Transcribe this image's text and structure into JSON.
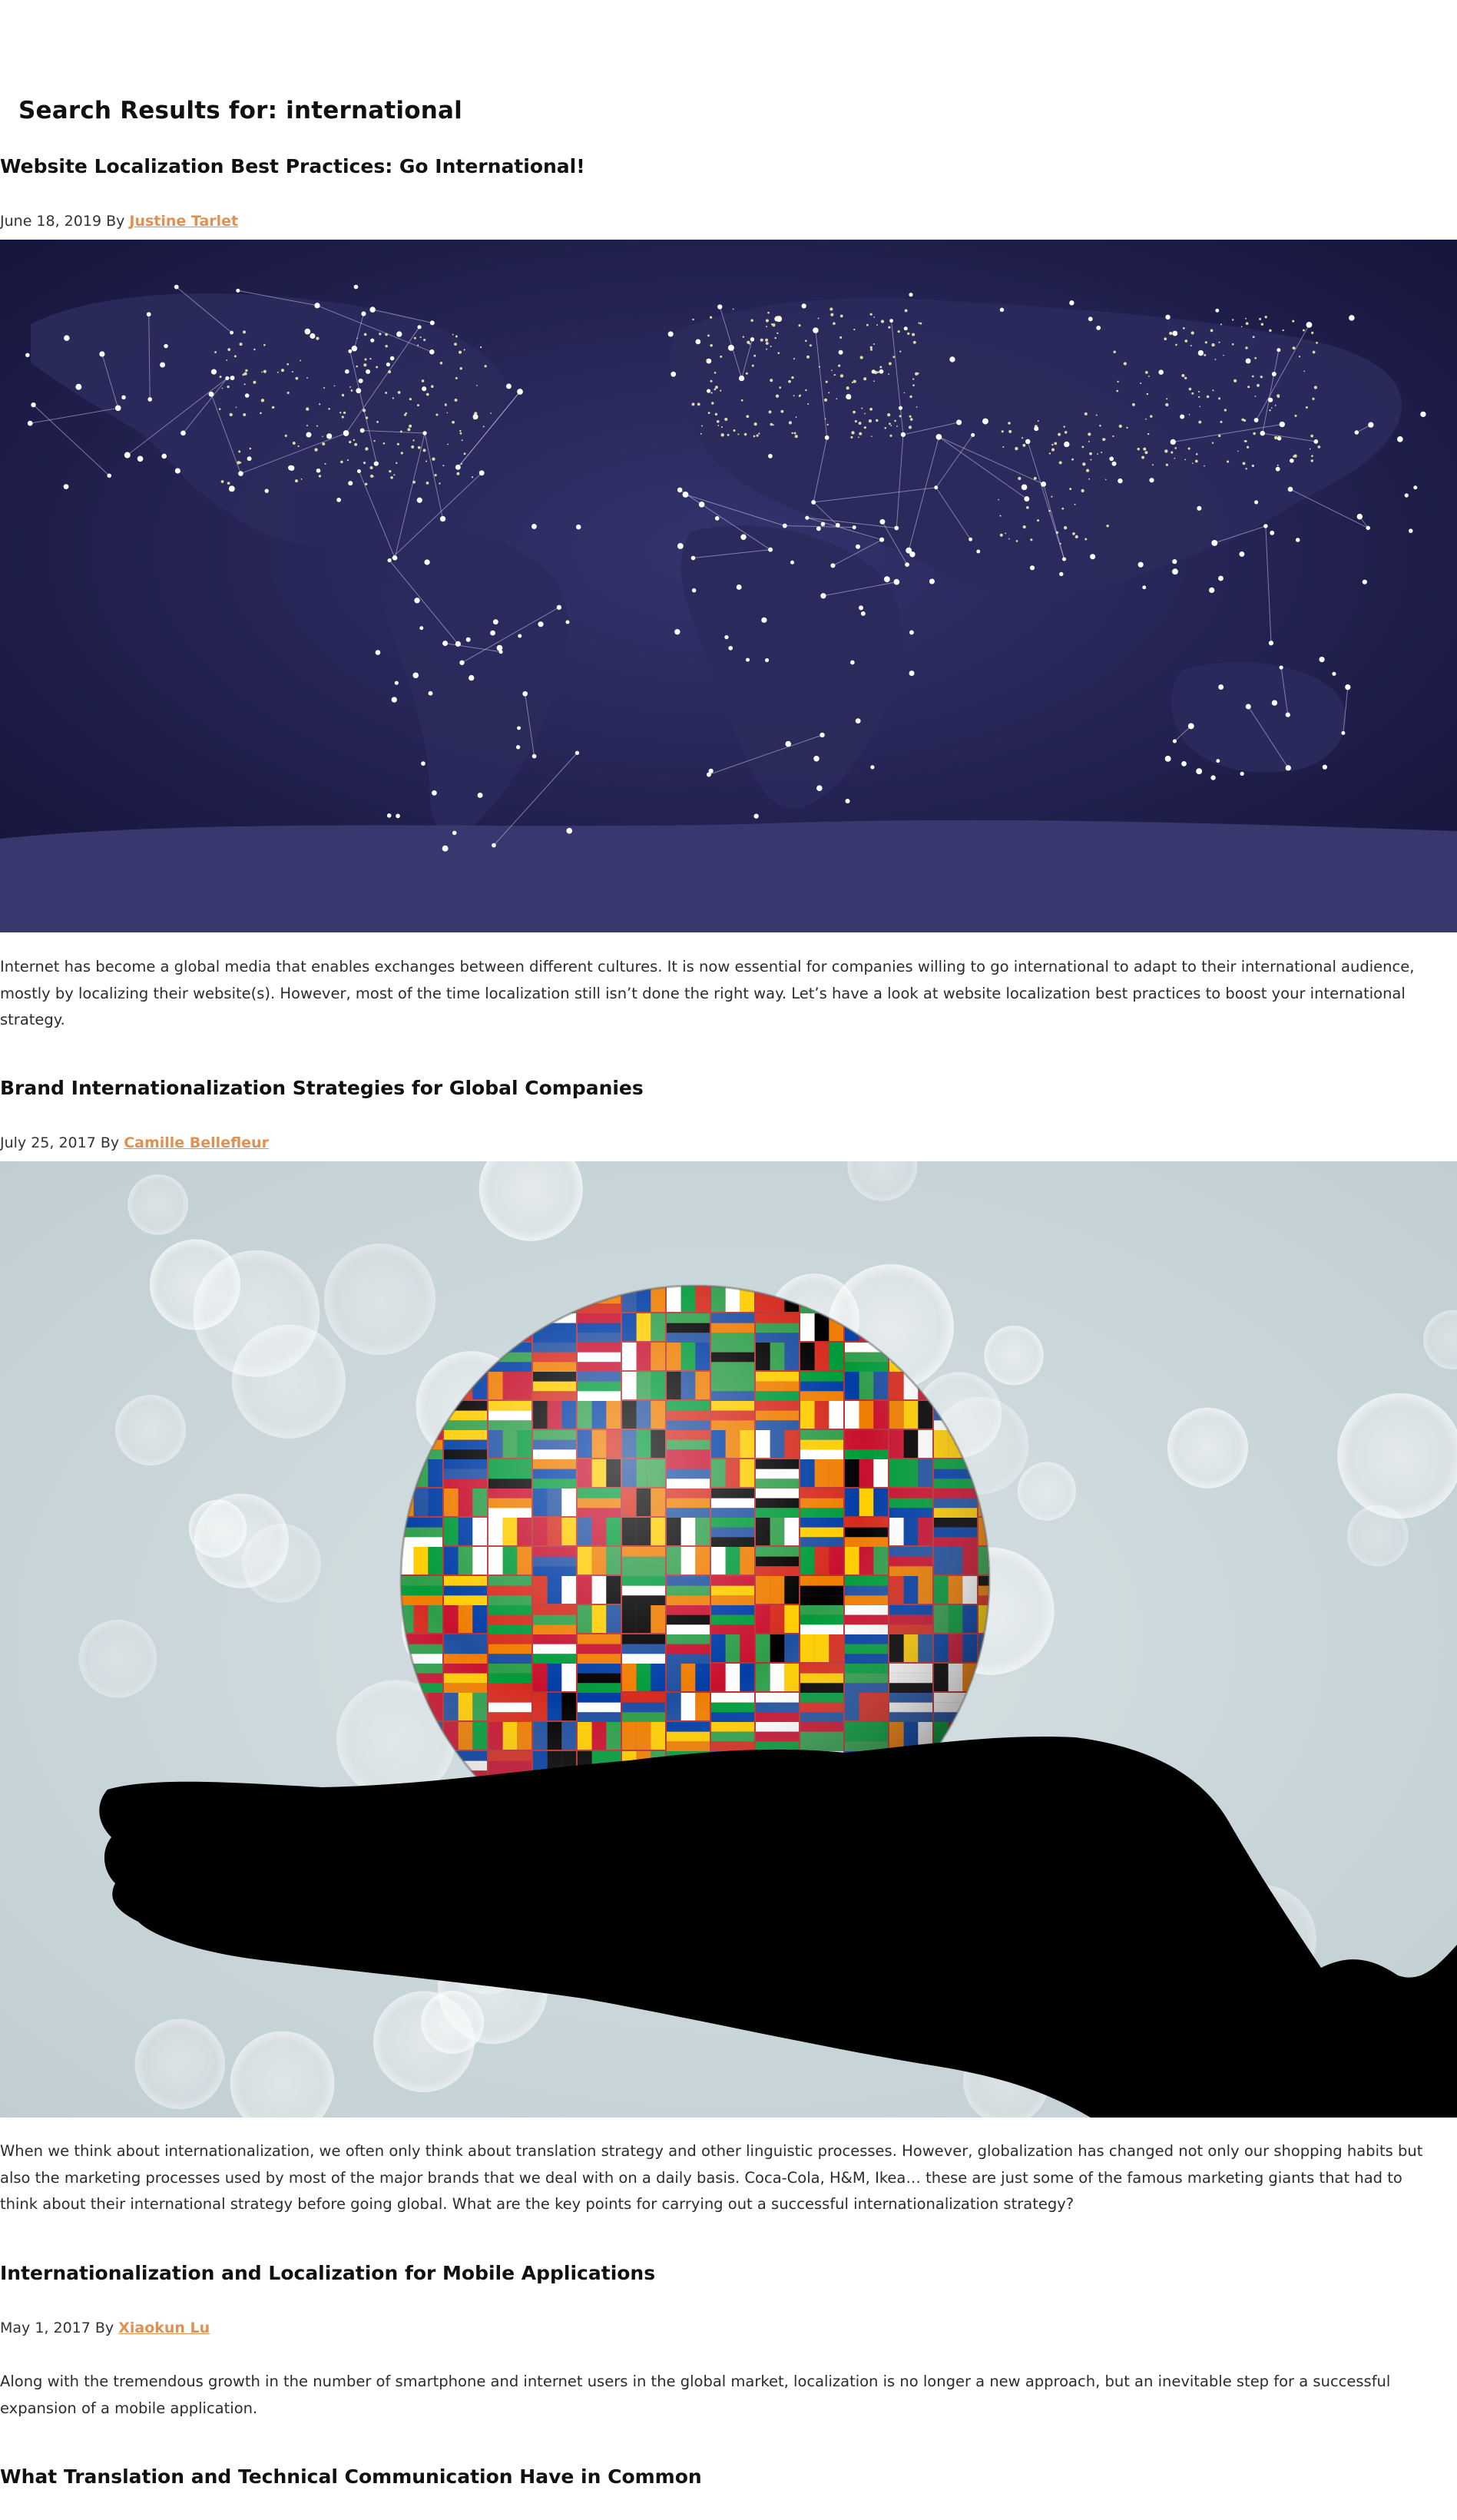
{
  "search": {
    "heading": "Search Results for: international"
  },
  "posts": [
    {
      "title": "Website Localization Best Practices: Go International!",
      "date": "June 18, 2019",
      "by": "By",
      "author": "Justine Tarlet",
      "excerpt": "Internet has become a global media that enables exchanges between different cultures. It is now essential for companies willing to go international to adapt to their international audience, mostly by localizing their website(s). However, most of the time localization still isn’t done the right way. Let’s have a look at website localization best practices to boost your international strategy."
    },
    {
      "title": "Brand Internationalization Strategies for Global Companies",
      "date": "July 25, 2017",
      "by": "By",
      "author": "Camille Bellefleur",
      "excerpt": "When we think about internationalization, we often only think about translation strategy and other linguistic processes. However, globalization has changed not only our shopping habits but also the marketing processes used by most of the major brands that we deal with on a daily basis. Coca-Cola, H&M, Ikea… these are just some of the famous marketing giants that had to think about their international strategy before going global. What are the key points for carrying out a successful internationalization strategy?"
    },
    {
      "title": "Internationalization and Localization for Mobile Applications",
      "date": "May 1, 2017",
      "by": "By",
      "author": "Xiaokun Lu",
      "excerpt": "Along with the tremendous growth in the number of smartphone and internet users in the global market, localization is no longer a new approach, but an inevitable step for a successful expansion of a mobile application."
    },
    {
      "title": "What Translation and Technical Communication Have in Common"
    }
  ],
  "colors": {
    "link": "#e0914f",
    "map_bg": "#1d1c45",
    "bokeh_bg": "#c9d6d9"
  }
}
